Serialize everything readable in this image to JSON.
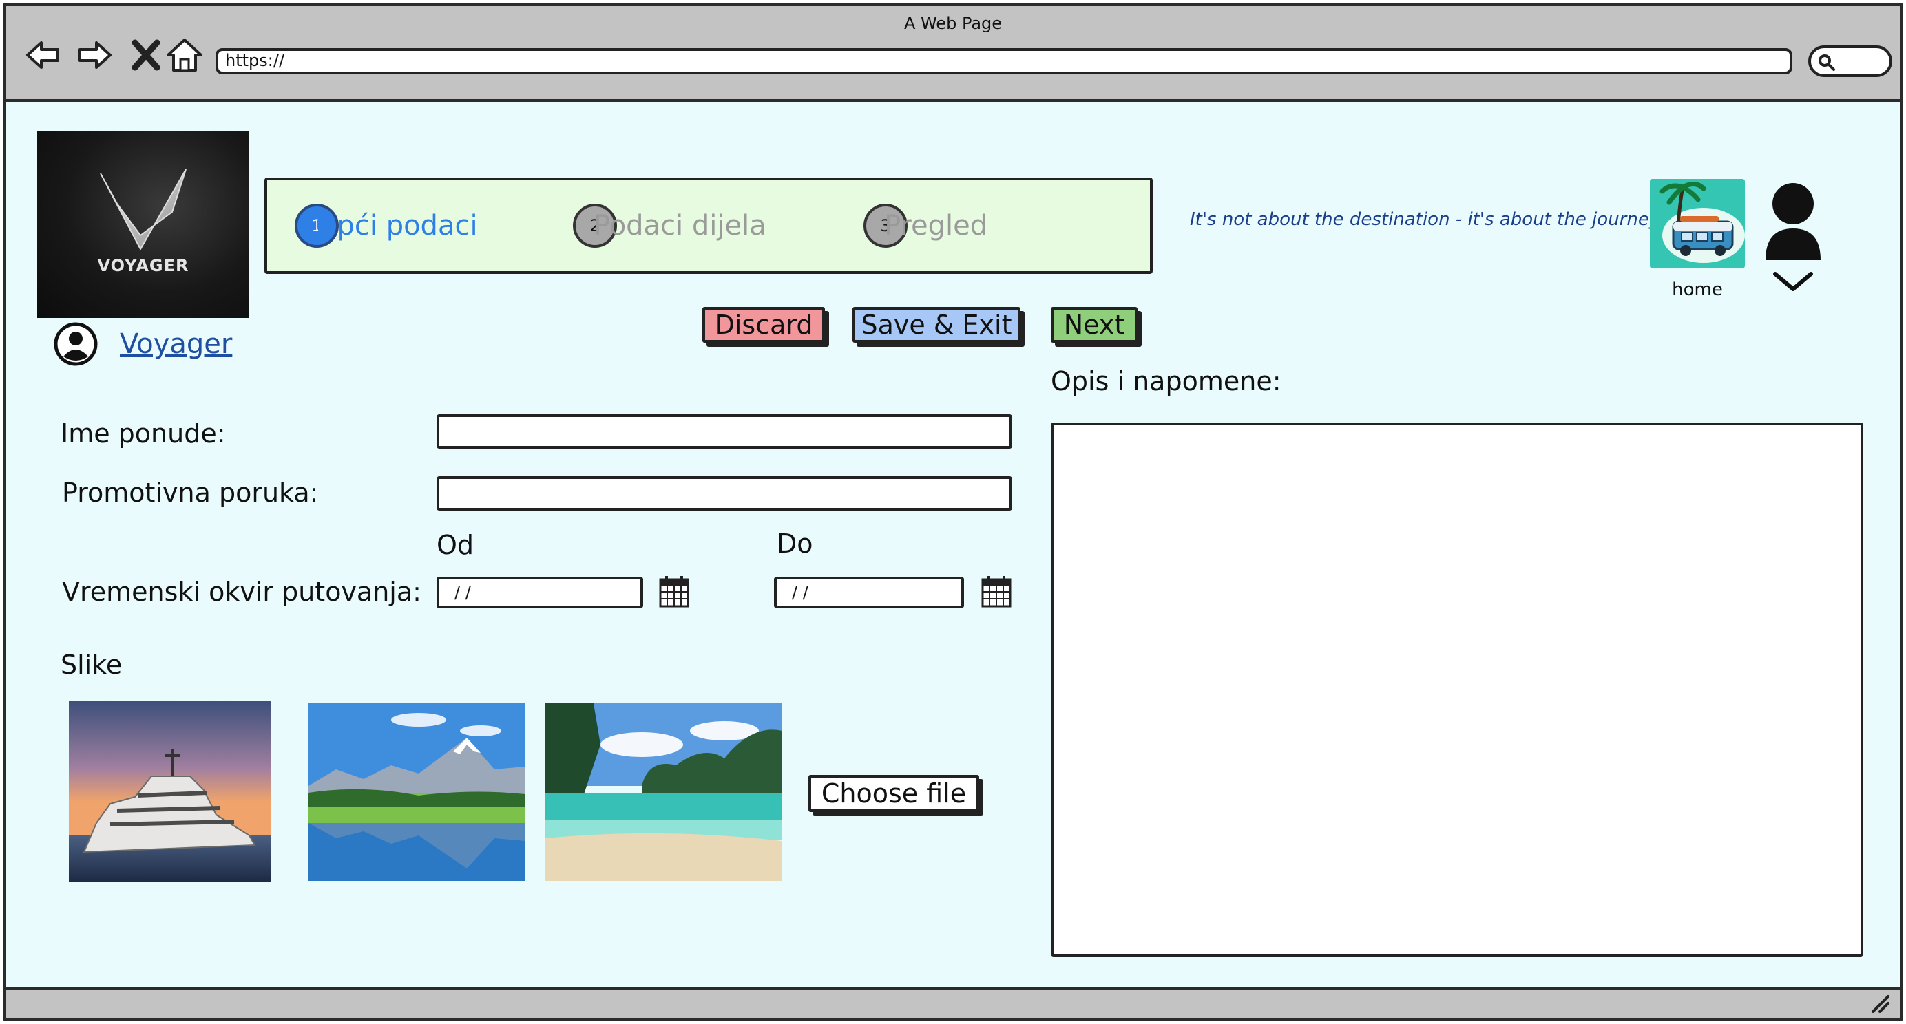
{
  "window": {
    "title": "A Web Page"
  },
  "browser": {
    "url": "https://",
    "icons": [
      "back-arrow-icon",
      "forward-arrow-icon",
      "stop-icon",
      "home-icon",
      "search-icon"
    ]
  },
  "brand": {
    "logo_text": "VOYAGER",
    "profile_name": "Voyager"
  },
  "stepper": {
    "steps": [
      {
        "number": "1",
        "label": "Opći podaci",
        "state": "active"
      },
      {
        "number": "2",
        "label": "Podaci dijela",
        "state": "todo"
      },
      {
        "number": "3",
        "label": "Pregled",
        "state": "todo"
      }
    ]
  },
  "tagline": "It's not about the destination - it's about the journey",
  "header": {
    "home_label": "home"
  },
  "actions": {
    "discard": "Discard",
    "save_exit": "Save & Exit",
    "next": "Next"
  },
  "form": {
    "offer_name_label": "Ime ponude:",
    "offer_name_value": "",
    "promo_label": "Promotivna poruka:",
    "promo_value": "",
    "from_label": "Od",
    "to_label": "Do",
    "timeframe_label": "Vremenski okvir putovanja:",
    "date_from": "/ /",
    "date_to": "/ /",
    "images_label": "Slike",
    "choose_file": "Choose file"
  },
  "notes": {
    "label": "Opis i napomene:",
    "value": ""
  },
  "colors": {
    "page_bg": "#e9fbfd",
    "chrome": "#c3c3c3",
    "stepper_bg": "#e7fbe0",
    "active_step": "#2f80e6",
    "discard": "#f1979b",
    "save": "#a7c8f7",
    "next": "#8fce7a",
    "link": "#1f4fa0"
  }
}
